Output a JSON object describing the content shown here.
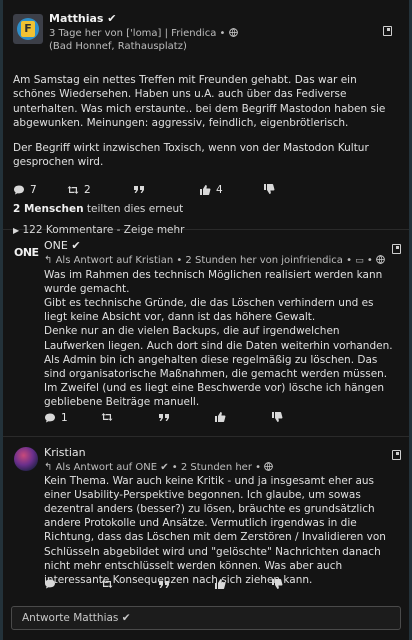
{
  "post": {
    "author": "Matthias ✔",
    "meta_line": "3 Tage her von ['loma] | Friendica •",
    "location": "(Bad Honnef, Rathausplatz)",
    "paragraphs": [
      "Am Samstag ein nettes Treffen mit Freunden gehabt. Das war ein schönes Wiedersehen. Haben uns u.A. auch über das Fediverse unterhalten. Was mich erstaunte.. bei dem Begriff Mastodon haben sie abgewunken. Meinungen: aggressiv, feindlich, eigenbrötlerisch.",
      "Der Begriff wirkt inzwischen Toxisch, wenn von der Mastodon Kultur gesprochen wird."
    ],
    "comments_count": "7",
    "reshares_count": "2",
    "likes_count": "4",
    "reshared_by_count": "2 Menschen",
    "reshared_by_text": "teilten dies erneut",
    "comments_toggle": "122 Kommentare - Zeige mehr"
  },
  "comments": [
    {
      "author": "ONE ✔",
      "avatar_text": "ONE",
      "meta": "Als Antwort auf Kristian • 2 Stunden her von joinfriendica •",
      "text": "Was im Rahmen des technisch Möglichen realisiert werden kann wurde gemacht.\nGibt es technische Gründe, die das Löschen verhindern und es liegt keine Absicht vor, dann ist das höhere Gewalt.\nDenke nur an die vielen Backups, die auf irgendwelchen Laufwerken liegen. Auch dort sind die Daten weiterhin vorhanden. Als Admin bin ich angehalten diese regelmäßig zu löschen. Das sind organisatorische Maßnahmen, die gemacht werden müssen.\nIm Zweifel (und es liegt eine Beschwerde vor) lösche ich hängen gebliebene Beiträge manuell.",
      "comments_count": "1"
    },
    {
      "author": "Kristian",
      "meta": "Als Antwort auf ONE ✔ • 2 Stunden her •",
      "text": "Kein Thema. War auch keine Kritik - und ja insgesamt eher aus einer Usability-Perspektive begonnen. Ich glaube, um sowas dezentral anders (besser?) zu lösen, bräuchte es grundsätzlich andere Protokolle und Ansätze. Vermutlich irgendwas in die Richtung, dass das Löschen mit dem Zerstören / Invalidieren von Schlüsseln abgebildet wird und \"gelöschte\" Nachrichten danach nicht mehr entschlüsselt werden können. Was aber auch interessante Konsequenzen nach sich ziehen kann."
    }
  ],
  "reply": {
    "placeholder": "Antworte Matthias ✔"
  },
  "icons": {
    "comment": "comment-icon",
    "reshare": "retweet-icon",
    "quote": "quote-icon",
    "like": "thumbs-up-icon",
    "dislike": "thumbs-down-icon",
    "menu": "context-menu-icon",
    "visibility": "globe-icon",
    "reply": "reply-arrow-icon",
    "client": "laptop-icon"
  }
}
